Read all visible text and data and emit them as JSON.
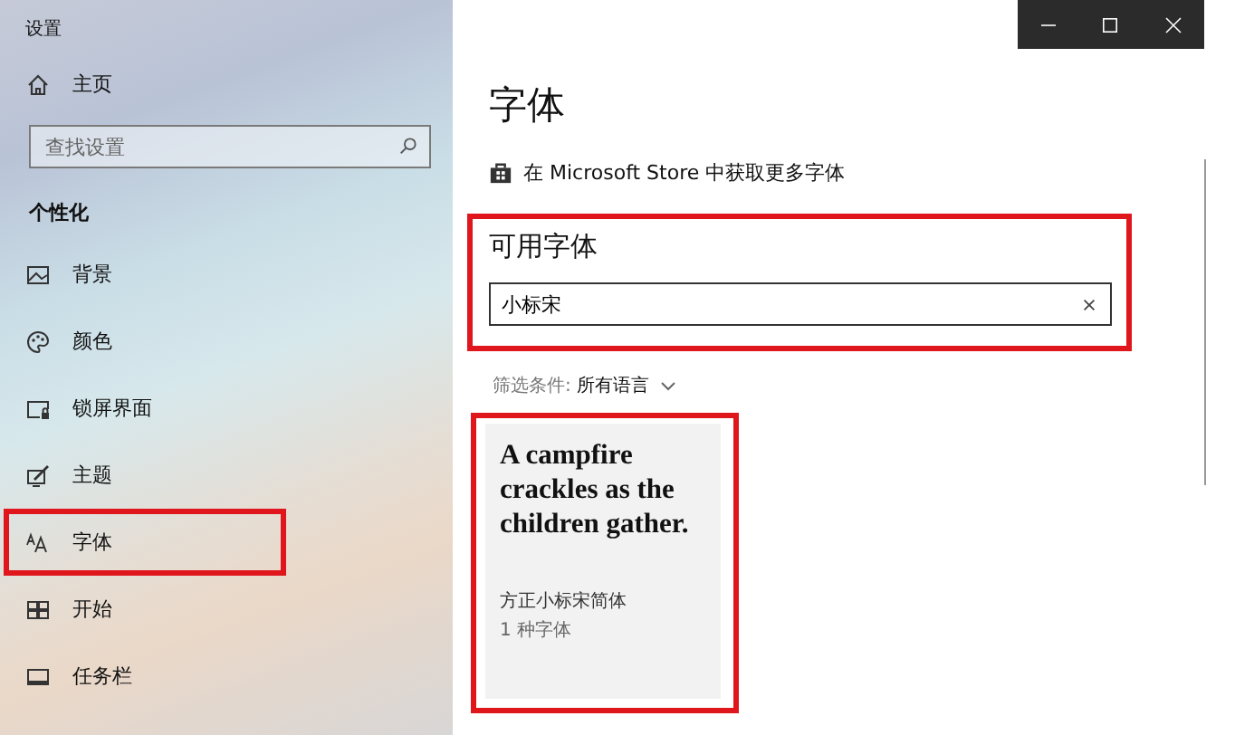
{
  "window": {
    "title": "设置"
  },
  "sidebar": {
    "home": {
      "label": "主页"
    },
    "search": {
      "placeholder": "查找设置"
    },
    "section": "个性化",
    "items": [
      {
        "label": "背景",
        "highlighted": false
      },
      {
        "label": "颜色",
        "highlighted": false
      },
      {
        "label": "锁屏界面",
        "highlighted": false
      },
      {
        "label": "主题",
        "highlighted": false
      },
      {
        "label": "字体",
        "highlighted": true
      },
      {
        "label": "开始",
        "highlighted": false
      },
      {
        "label": "任务栏",
        "highlighted": false
      }
    ]
  },
  "page": {
    "title": "字体",
    "store_link": "在 Microsoft Store 中获取更多字体",
    "available": {
      "title": "可用字体",
      "highlighted": true,
      "search": {
        "value": "小标宋"
      }
    },
    "filter": {
      "label": "筛选条件:",
      "value": "所有语言"
    },
    "fonts": [
      {
        "sample": "A campfire crackles as the children gather.",
        "name": "方正小标宋简体",
        "count": "1 种字体",
        "highlighted": true
      }
    ]
  }
}
